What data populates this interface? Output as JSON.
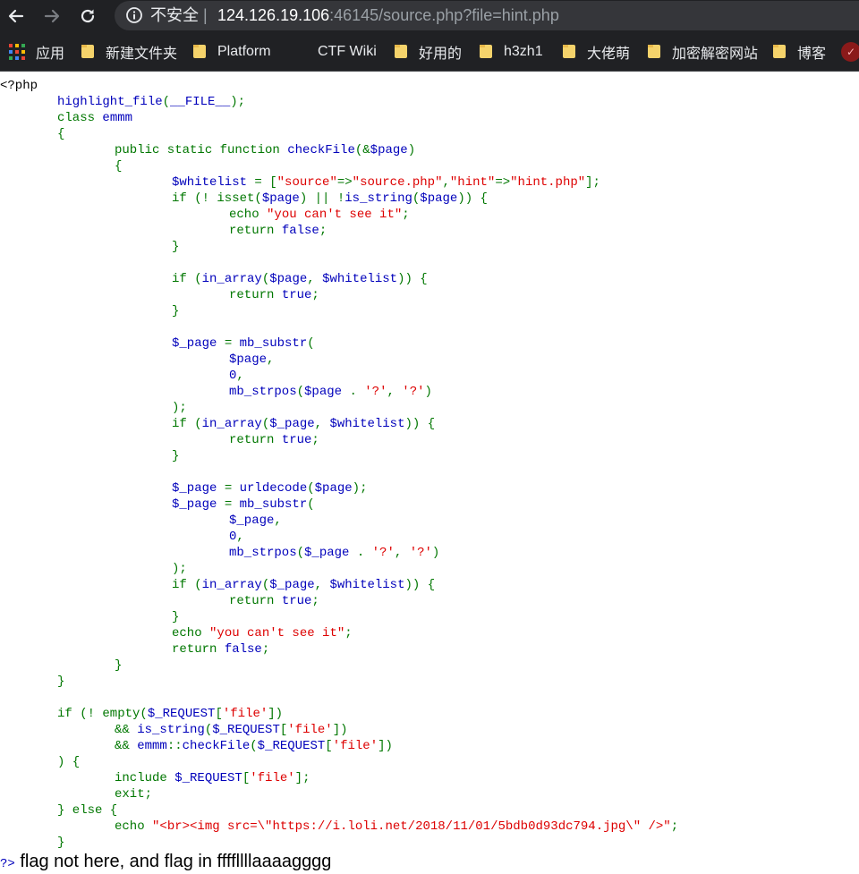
{
  "browser": {
    "security_label": "不安全",
    "separator": "|",
    "url_host": "124.126.19.106",
    "url_rest": ":46145/source.php?file=hint.php"
  },
  "bookmarks": [
    {
      "label": "应用",
      "icon": "apps-grid-icon"
    },
    {
      "label": "新建文件夹",
      "icon": "folder-icon"
    },
    {
      "label": "Platform",
      "icon": "folder-icon"
    },
    {
      "label": "CTF Wiki",
      "icon": "none"
    },
    {
      "label": "好用的",
      "icon": "folder-icon"
    },
    {
      "label": "h3zh1",
      "icon": "folder-icon"
    },
    {
      "label": "大佬萌",
      "icon": "folder-icon"
    },
    {
      "label": "加密解密网站",
      "icon": "folder-icon"
    },
    {
      "label": "博客",
      "icon": "folder-icon"
    }
  ],
  "colors": {
    "php_default": "#0000bb",
    "php_keyword": "#007700",
    "php_string": "#dd0000",
    "php_tag": "#000000"
  },
  "source_code": [
    [
      [
        "tag",
        "<?php"
      ]
    ],
    [
      [
        "def",
        "highlight_file"
      ],
      [
        "kw",
        "("
      ],
      [
        "def",
        "__FILE__"
      ],
      [
        "kw",
        ");"
      ]
    ],
    [
      [
        "kw",
        "class "
      ],
      [
        "def",
        "emmm"
      ]
    ],
    [
      [
        "kw",
        "{"
      ]
    ],
    [
      [
        "kw",
        "public static function "
      ],
      [
        "def",
        "checkFile"
      ],
      [
        "kw",
        "(&"
      ],
      [
        "def",
        "$page"
      ],
      [
        "kw",
        ")"
      ]
    ],
    [
      [
        "kw",
        "{"
      ]
    ],
    [
      [
        "def",
        "$whitelist "
      ],
      [
        "kw",
        "= ["
      ],
      [
        "str",
        "\"source\""
      ],
      [
        "kw",
        "=>"
      ],
      [
        "str",
        "\"source.php\""
      ],
      [
        "kw",
        ","
      ],
      [
        "str",
        "\"hint\""
      ],
      [
        "kw",
        "=>"
      ],
      [
        "str",
        "\"hint.php\""
      ],
      [
        "kw",
        "];"
      ]
    ],
    [
      [
        "kw",
        "if (! isset("
      ],
      [
        "def",
        "$page"
      ],
      [
        "kw",
        ") || !"
      ],
      [
        "def",
        "is_string"
      ],
      [
        "kw",
        "("
      ],
      [
        "def",
        "$page"
      ],
      [
        "kw",
        ")) {"
      ]
    ],
    [
      [
        "kw",
        "echo "
      ],
      [
        "str",
        "\"you can't see it\""
      ],
      [
        "kw",
        ";"
      ]
    ],
    [
      [
        "kw",
        "return "
      ],
      [
        "def",
        "false"
      ],
      [
        "kw",
        ";"
      ]
    ],
    [
      [
        "kw",
        "}"
      ]
    ],
    [],
    [
      [
        "kw",
        "if ("
      ],
      [
        "def",
        "in_array"
      ],
      [
        "kw",
        "("
      ],
      [
        "def",
        "$page"
      ],
      [
        "kw",
        ", "
      ],
      [
        "def",
        "$whitelist"
      ],
      [
        "kw",
        ")) {"
      ]
    ],
    [
      [
        "kw",
        "return "
      ],
      [
        "def",
        "true"
      ],
      [
        "kw",
        ";"
      ]
    ],
    [
      [
        "kw",
        "}"
      ]
    ],
    [],
    [
      [
        "def",
        "$_page "
      ],
      [
        "kw",
        "= "
      ],
      [
        "def",
        "mb_substr"
      ],
      [
        "kw",
        "("
      ]
    ],
    [
      [
        "def",
        "$page"
      ],
      [
        "kw",
        ","
      ]
    ],
    [
      [
        "def",
        "0"
      ],
      [
        "kw",
        ","
      ]
    ],
    [
      [
        "def",
        "mb_strpos"
      ],
      [
        "kw",
        "("
      ],
      [
        "def",
        "$page "
      ],
      [
        "kw",
        ". "
      ],
      [
        "str",
        "'?'"
      ],
      [
        "kw",
        ", "
      ],
      [
        "str",
        "'?'"
      ],
      [
        "kw",
        ")"
      ]
    ],
    [
      [
        "kw",
        ");"
      ]
    ],
    [
      [
        "kw",
        "if ("
      ],
      [
        "def",
        "in_array"
      ],
      [
        "kw",
        "("
      ],
      [
        "def",
        "$_page"
      ],
      [
        "kw",
        ", "
      ],
      [
        "def",
        "$whitelist"
      ],
      [
        "kw",
        ")) {"
      ]
    ],
    [
      [
        "kw",
        "return "
      ],
      [
        "def",
        "true"
      ],
      [
        "kw",
        ";"
      ]
    ],
    [
      [
        "kw",
        "}"
      ]
    ],
    [],
    [
      [
        "def",
        "$_page "
      ],
      [
        "kw",
        "= "
      ],
      [
        "def",
        "urldecode"
      ],
      [
        "kw",
        "("
      ],
      [
        "def",
        "$page"
      ],
      [
        "kw",
        ");"
      ]
    ],
    [
      [
        "def",
        "$_page "
      ],
      [
        "kw",
        "= "
      ],
      [
        "def",
        "mb_substr"
      ],
      [
        "kw",
        "("
      ]
    ],
    [
      [
        "def",
        "$_page"
      ],
      [
        "kw",
        ","
      ]
    ],
    [
      [
        "def",
        "0"
      ],
      [
        "kw",
        ","
      ]
    ],
    [
      [
        "def",
        "mb_strpos"
      ],
      [
        "kw",
        "("
      ],
      [
        "def",
        "$_page "
      ],
      [
        "kw",
        ". "
      ],
      [
        "str",
        "'?'"
      ],
      [
        "kw",
        ", "
      ],
      [
        "str",
        "'?'"
      ],
      [
        "kw",
        ")"
      ]
    ],
    [
      [
        "kw",
        ");"
      ]
    ],
    [
      [
        "kw",
        "if ("
      ],
      [
        "def",
        "in_array"
      ],
      [
        "kw",
        "("
      ],
      [
        "def",
        "$_page"
      ],
      [
        "kw",
        ", "
      ],
      [
        "def",
        "$whitelist"
      ],
      [
        "kw",
        ")) {"
      ]
    ],
    [
      [
        "kw",
        "return "
      ],
      [
        "def",
        "true"
      ],
      [
        "kw",
        ";"
      ]
    ],
    [
      [
        "kw",
        "}"
      ]
    ],
    [
      [
        "kw",
        "echo "
      ],
      [
        "str",
        "\"you can't see it\""
      ],
      [
        "kw",
        ";"
      ]
    ],
    [
      [
        "kw",
        "return "
      ],
      [
        "def",
        "false"
      ],
      [
        "kw",
        ";"
      ]
    ],
    [
      [
        "kw",
        "}"
      ]
    ],
    [
      [
        "kw",
        "}"
      ]
    ],
    [],
    [
      [
        "kw",
        "if (! empty("
      ],
      [
        "def",
        "$_REQUEST"
      ],
      [
        "kw",
        "["
      ],
      [
        "str",
        "'file'"
      ],
      [
        "kw",
        "])"
      ]
    ],
    [
      [
        "kw",
        "&& "
      ],
      [
        "def",
        "is_string"
      ],
      [
        "kw",
        "("
      ],
      [
        "def",
        "$_REQUEST"
      ],
      [
        "kw",
        "["
      ],
      [
        "str",
        "'file'"
      ],
      [
        "kw",
        "])"
      ]
    ],
    [
      [
        "kw",
        "&& "
      ],
      [
        "def",
        "emmm"
      ],
      [
        "kw",
        "::"
      ],
      [
        "def",
        "checkFile"
      ],
      [
        "kw",
        "("
      ],
      [
        "def",
        "$_REQUEST"
      ],
      [
        "kw",
        "["
      ],
      [
        "str",
        "'file'"
      ],
      [
        "kw",
        "])"
      ]
    ],
    [
      [
        "kw",
        ") {"
      ]
    ],
    [
      [
        "kw",
        "include "
      ],
      [
        "def",
        "$_REQUEST"
      ],
      [
        "kw",
        "["
      ],
      [
        "str",
        "'file'"
      ],
      [
        "kw",
        "];"
      ]
    ],
    [
      [
        "kw",
        "exit;"
      ]
    ],
    [
      [
        "kw",
        "} else {"
      ]
    ],
    [
      [
        "kw",
        "echo "
      ],
      [
        "str",
        "\"<br><img src=\\\"https://i.loli.net/2018/11/01/5bdb0d93dc794.jpg\\\" />\""
      ],
      [
        "kw",
        ";"
      ]
    ],
    [
      [
        "kw",
        "}"
      ]
    ]
  ],
  "output": {
    "close_tag": "?>",
    "message": "flag not here, and flag in ffffllllaaaagggg"
  }
}
